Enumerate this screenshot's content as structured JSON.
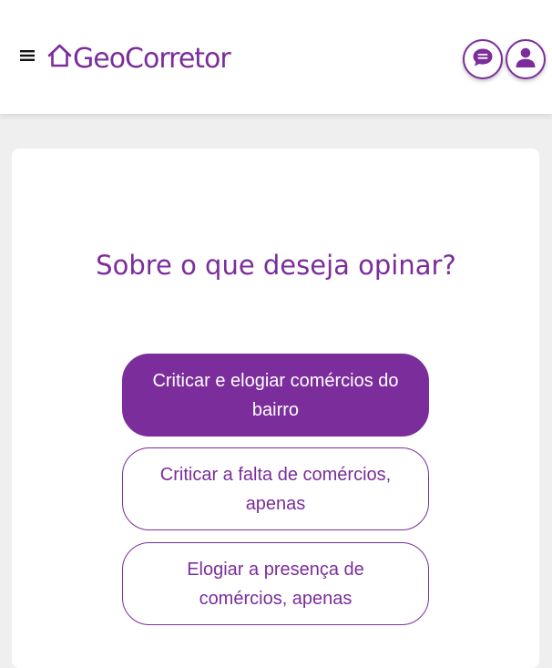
{
  "header": {
    "logo_text": "GeoCorretor",
    "menu_icon": "hamburger-icon",
    "chat_icon": "chat-bubble-icon",
    "user_icon": "user-icon"
  },
  "colors": {
    "brand": "#7b2d9b",
    "background": "#efefef",
    "card": "#ffffff"
  },
  "main": {
    "question": "Sobre o que deseja opinar?",
    "options": [
      {
        "label": "Criticar e elogiar comércios do bairro",
        "selected": true
      },
      {
        "label": "Criticar a falta de comércios, apenas",
        "selected": false
      },
      {
        "label": "Elogiar a presença de comércios, apenas",
        "selected": false
      }
    ]
  }
}
